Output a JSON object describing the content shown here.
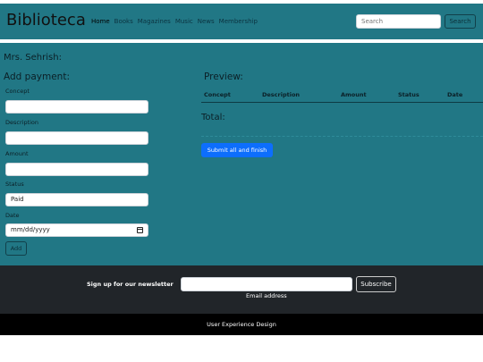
{
  "navbar": {
    "brand": "Biblioteca",
    "links": [
      "Home",
      "Books",
      "Magazines",
      "Music",
      "News",
      "Membership"
    ],
    "search_placeholder": "Search",
    "search_button": "Search"
  },
  "greeting": "Mrs. Sehrish:",
  "form": {
    "title": "Add payment:",
    "concept_label": "Concept",
    "concept_value": "",
    "description_label": "Description",
    "description_value": "",
    "amount_label": "Amount",
    "amount_value": "",
    "status_label": "Status",
    "status_value": "Paid",
    "date_label": "Date",
    "date_placeholder": "mm/dd/yyyy",
    "add_button": "Add"
  },
  "preview": {
    "title": "Preview:",
    "columns": [
      "Concept",
      "Description",
      "Amount",
      "Status",
      "Date"
    ],
    "rows": [],
    "total_label": "Total:",
    "submit_button": "Submit all and finish"
  },
  "newsletter": {
    "label": "Sign up for our newsletter",
    "input_value": "",
    "help_text": "Email address",
    "button": "Subscribe"
  },
  "footer": {
    "text": "User Experience Design"
  },
  "colors": {
    "main_bg": "#217785",
    "newsletter_bg": "#212529",
    "footer_bg": "#000000",
    "submit_btn": "#0d6efd"
  }
}
